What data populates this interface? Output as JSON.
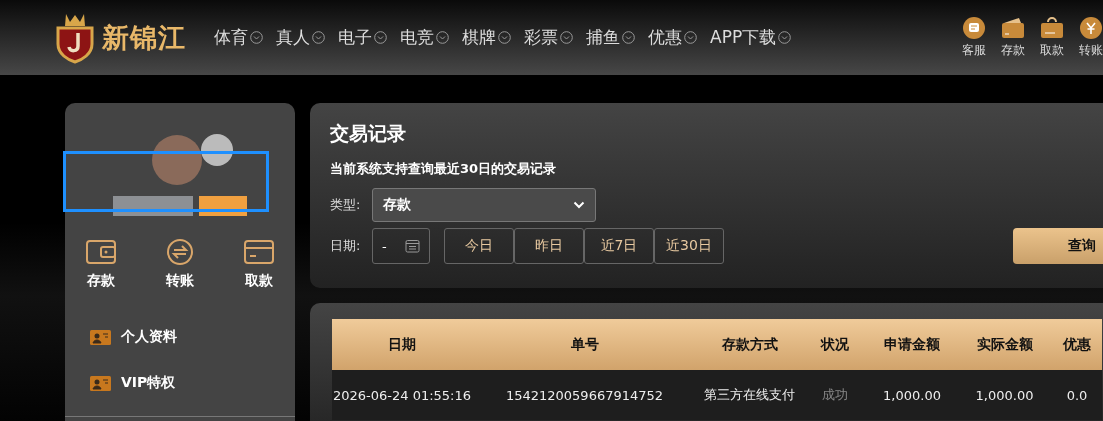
{
  "header": {
    "logo": "新锦江",
    "nav": [
      {
        "label": "体育"
      },
      {
        "label": "真人"
      },
      {
        "label": "电子"
      },
      {
        "label": "电竞"
      },
      {
        "label": "棋牌"
      },
      {
        "label": "彩票"
      },
      {
        "label": "捕鱼"
      },
      {
        "label": "优惠"
      },
      {
        "label": "APP下载"
      }
    ],
    "actions": [
      {
        "kind": "chat",
        "label": "客服"
      },
      {
        "kind": "wallet",
        "label": "存款"
      },
      {
        "kind": "case",
        "label": "取款"
      },
      {
        "kind": "yen",
        "label": "转账"
      }
    ]
  },
  "sidebar": {
    "quick_actions": [
      {
        "kind": "wallet",
        "label": "存款"
      },
      {
        "kind": "transfer",
        "label": "转账"
      },
      {
        "kind": "card",
        "label": "取款"
      }
    ],
    "menu": [
      {
        "label": "个人资料"
      },
      {
        "label": "VIP特权"
      }
    ]
  },
  "filter": {
    "title": "交易记录",
    "note": "当前系统支持查询最近30日的交易记录",
    "type_label": "类型:",
    "type_value": "存款",
    "date_label": "日期:",
    "date_value": "-",
    "ranges": [
      {
        "label": "今日"
      },
      {
        "label": "昨日"
      },
      {
        "label": "近7日"
      },
      {
        "label": "近30日"
      }
    ],
    "submit": "查询"
  },
  "table": {
    "columns": [
      "日期",
      "单号",
      "存款方式",
      "状况",
      "申请金额",
      "实际金额",
      "优惠"
    ],
    "rows": [
      {
        "cells": [
          "2026-06-24 01:55:16",
          "1542120059667914752",
          "第三方在线支付",
          "成功",
          "1,000.00",
          "1,000.00",
          "0.0"
        ]
      }
    ]
  }
}
